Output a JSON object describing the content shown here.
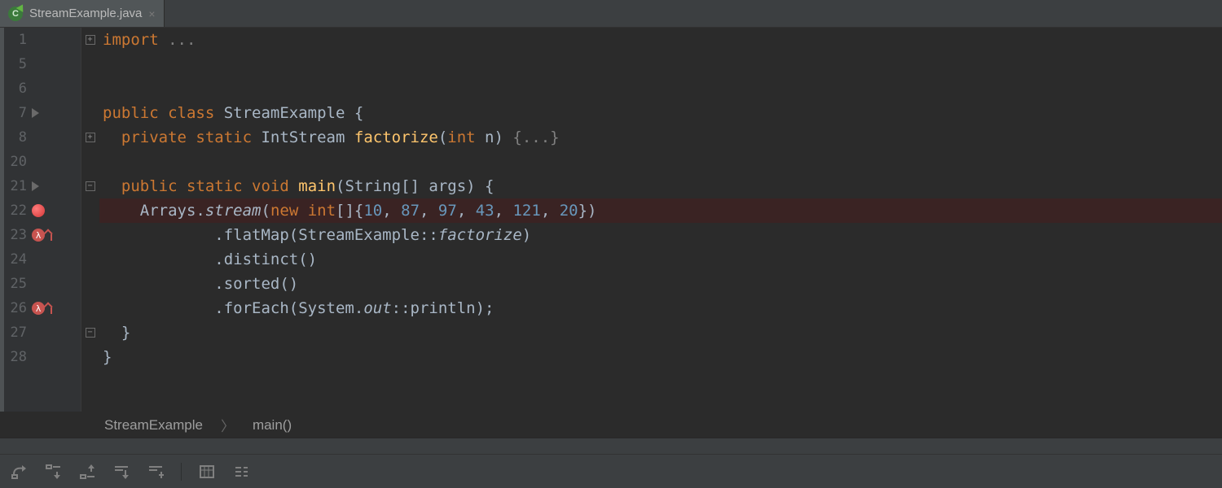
{
  "tab": {
    "filename": "StreamExample.java",
    "icon_letter": "C"
  },
  "lines": {
    "numbers": [
      "1",
      "5",
      "6",
      "7",
      "8",
      "20",
      "21",
      "22",
      "23",
      "24",
      "25",
      "26",
      "27",
      "28"
    ]
  },
  "code": {
    "l1_kw": "import",
    "l1_fold": " ...",
    "l7_public": "public ",
    "l7_class": "class ",
    "l7_name": "StreamExample {",
    "l8_private": "private ",
    "l8_static": "static ",
    "l8_type": "IntStream ",
    "l8_fn": "factorize",
    "l8_paren_open": "(",
    "l8_int": "int ",
    "l8_param": "n) ",
    "l8_fold": "{...}",
    "l21_public": "public ",
    "l21_static": "static ",
    "l21_void": "void ",
    "l21_fn": "main",
    "l21_rest": "(String[] args) {",
    "l22_pre": "Arrays.",
    "l22_stream": "stream",
    "l22_open": "(",
    "l22_new": "new ",
    "l22_int": "int",
    "l22_arr": "[]{",
    "l22_n1": "10",
    "l22_c1": ", ",
    "l22_n2": "87",
    "l22_c2": ", ",
    "l22_n3": "97",
    "l22_c3": ", ",
    "l22_n4": "43",
    "l22_c4": ", ",
    "l22_n5": "121",
    "l22_c5": ", ",
    "l22_n6": "20",
    "l22_close": "})",
    "l23": ".flatMap(StreamExample::",
    "l23_fn": "factorize",
    "l23_end": ")",
    "l24": ".distinct()",
    "l25": ".sorted()",
    "l26_a": ".forEach(System.",
    "l26_out": "out",
    "l26_b": "::println);",
    "l27": "}",
    "l28": "}"
  },
  "breadcrumb": {
    "class": "StreamExample",
    "sep": "〉",
    "method": "main()"
  }
}
